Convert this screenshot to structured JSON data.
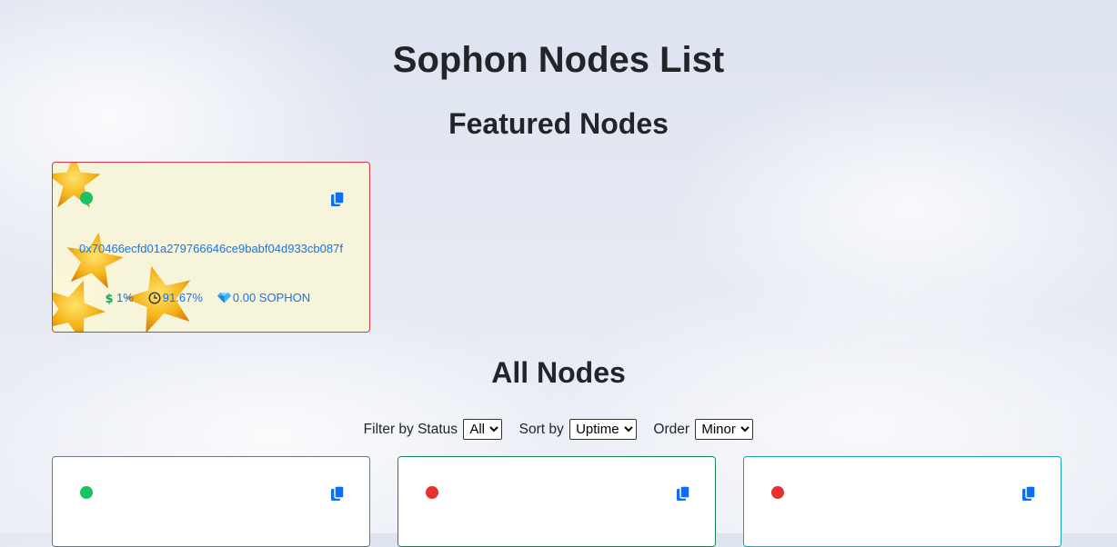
{
  "page": {
    "title": "Sophon Nodes List"
  },
  "featured": {
    "title": "Featured Nodes",
    "node": {
      "status_color": "#19c35f",
      "address": "0x70466ecfd01a279766646ce9babf04d933cb087f",
      "fee": "1%",
      "uptime": "91.67%",
      "rewards": "0.00 SOPHON"
    }
  },
  "all_nodes": {
    "title": "All Nodes",
    "filters": {
      "status_label": "Filter by Status",
      "status_value": "All",
      "sort_label": "Sort by",
      "sort_value": "Uptime",
      "order_label": "Order",
      "order_value": "Minor"
    },
    "nodes": [
      {
        "status_color": "#19c35f",
        "border_color": "#6c757d"
      },
      {
        "status_color": "#e8302f",
        "border_color": "#198754"
      },
      {
        "status_color": "#e8302f",
        "border_color": "#17a2b8"
      }
    ]
  },
  "colors": {
    "link": "#1a73e8",
    "featured_border": "#dc3545",
    "featured_bg": "#f6f5dc"
  },
  "icons": {
    "copy": "copy-icon",
    "fee": "dollar-icon",
    "uptime": "clock-icon",
    "rewards": "diamond-icon"
  }
}
